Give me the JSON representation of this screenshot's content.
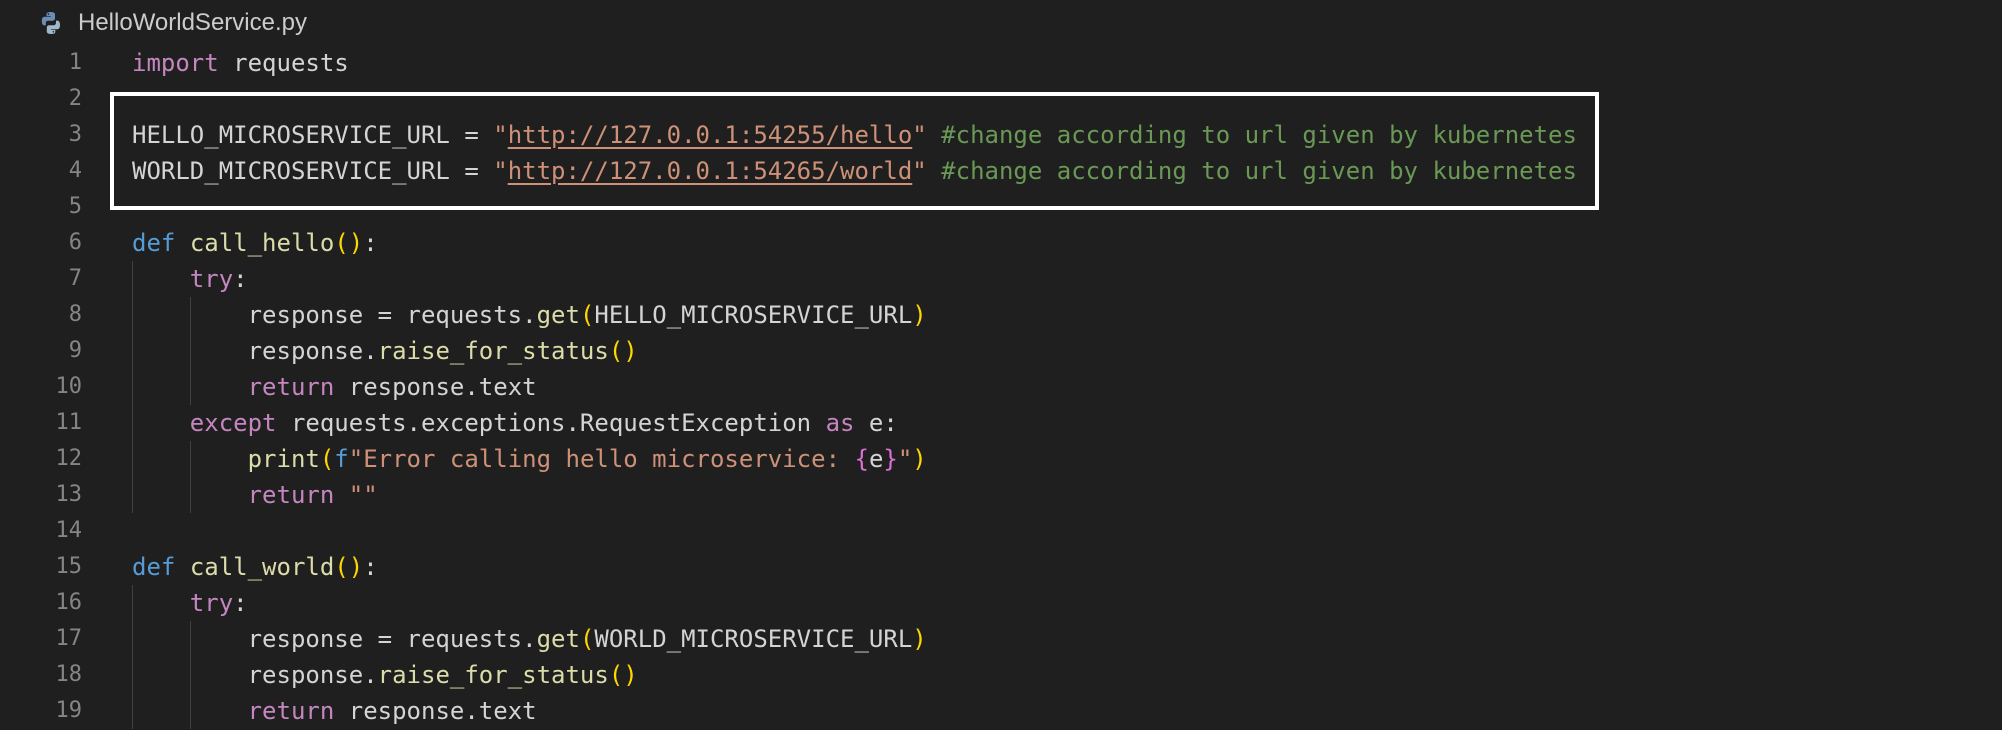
{
  "tab": {
    "filename": "HelloWorldService.py",
    "icon": "python-file-icon"
  },
  "lines": [
    {
      "n": "1",
      "tokens": [
        [
          "kw",
          "import"
        ],
        [
          "plain",
          " requests"
        ]
      ]
    },
    {
      "n": "2",
      "tokens": []
    },
    {
      "n": "3",
      "tokens": [
        [
          "plain",
          "HELLO_MICROSERVICE_URL = "
        ],
        [
          "str",
          "\""
        ],
        [
          "url",
          "http://127.0.0.1:54255/hello"
        ],
        [
          "str",
          "\""
        ],
        [
          "plain",
          " "
        ],
        [
          "cmt",
          "#change according to url given by kubernetes"
        ]
      ]
    },
    {
      "n": "4",
      "tokens": [
        [
          "plain",
          "WORLD_MICROSERVICE_URL = "
        ],
        [
          "str",
          "\""
        ],
        [
          "url",
          "http://127.0.0.1:54265/world"
        ],
        [
          "str",
          "\""
        ],
        [
          "plain",
          " "
        ],
        [
          "cmt",
          "#change according to url given by kubernetes"
        ]
      ]
    },
    {
      "n": "5",
      "tokens": []
    },
    {
      "n": "6",
      "tokens": [
        [
          "def",
          "def"
        ],
        [
          "plain",
          " "
        ],
        [
          "fn",
          "call_hello"
        ],
        [
          "br",
          "()"
        ],
        [
          "plain",
          ":"
        ]
      ]
    },
    {
      "n": "7",
      "tokens": [
        [
          "plain",
          "    "
        ],
        [
          "kw",
          "try"
        ],
        [
          "plain",
          ":"
        ]
      ]
    },
    {
      "n": "8",
      "tokens": [
        [
          "plain",
          "        response = requests."
        ],
        [
          "fn",
          "get"
        ],
        [
          "br",
          "("
        ],
        [
          "plain",
          "HELLO_MICROSERVICE_URL"
        ],
        [
          "br",
          ")"
        ]
      ]
    },
    {
      "n": "9",
      "tokens": [
        [
          "plain",
          "        response."
        ],
        [
          "fn",
          "raise_for_status"
        ],
        [
          "br",
          "()"
        ]
      ]
    },
    {
      "n": "10",
      "tokens": [
        [
          "plain",
          "        "
        ],
        [
          "kw",
          "return"
        ],
        [
          "plain",
          " response.text"
        ]
      ]
    },
    {
      "n": "11",
      "tokens": [
        [
          "plain",
          "    "
        ],
        [
          "kw",
          "except"
        ],
        [
          "plain",
          " requests.exceptions.RequestException "
        ],
        [
          "kw",
          "as"
        ],
        [
          "plain",
          " e:"
        ]
      ]
    },
    {
      "n": "12",
      "tokens": [
        [
          "plain",
          "        "
        ],
        [
          "fn",
          "print"
        ],
        [
          "br",
          "("
        ],
        [
          "fpre",
          "f"
        ],
        [
          "str",
          "\"Error calling hello microservice: "
        ],
        [
          "br2",
          "{"
        ],
        [
          "plain",
          "e"
        ],
        [
          "br2",
          "}"
        ],
        [
          "str",
          "\""
        ],
        [
          "br",
          ")"
        ]
      ]
    },
    {
      "n": "13",
      "tokens": [
        [
          "plain",
          "        "
        ],
        [
          "kw",
          "return"
        ],
        [
          "plain",
          " "
        ],
        [
          "str",
          "\"\""
        ]
      ]
    },
    {
      "n": "14",
      "tokens": []
    },
    {
      "n": "15",
      "tokens": [
        [
          "def",
          "def"
        ],
        [
          "plain",
          " "
        ],
        [
          "fn",
          "call_world"
        ],
        [
          "br",
          "()"
        ],
        [
          "plain",
          ":"
        ]
      ]
    },
    {
      "n": "16",
      "tokens": [
        [
          "plain",
          "    "
        ],
        [
          "kw",
          "try"
        ],
        [
          "plain",
          ":"
        ]
      ]
    },
    {
      "n": "17",
      "tokens": [
        [
          "plain",
          "        response = requests."
        ],
        [
          "fn",
          "get"
        ],
        [
          "br",
          "("
        ],
        [
          "plain",
          "WORLD_MICROSERVICE_URL"
        ],
        [
          "br",
          ")"
        ]
      ]
    },
    {
      "n": "18",
      "tokens": [
        [
          "plain",
          "        response."
        ],
        [
          "fn",
          "raise_for_status"
        ],
        [
          "br",
          "()"
        ]
      ]
    },
    {
      "n": "19",
      "tokens": [
        [
          "plain",
          "        "
        ],
        [
          "kw",
          "return"
        ],
        [
          "plain",
          " response.text"
        ]
      ]
    }
  ],
  "colors": {
    "background": "#1f1f1f",
    "highlight_border": "#ffffff"
  }
}
